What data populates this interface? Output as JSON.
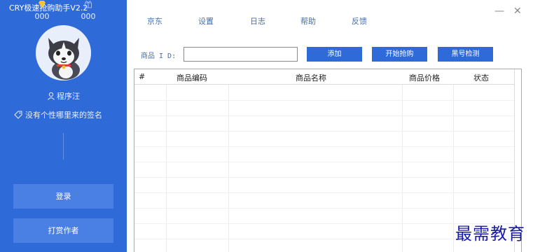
{
  "app": {
    "title": "CRY极速抢购助手V2.2"
  },
  "sidebar": {
    "username": "程序汪",
    "signature": "没有个性哪里来的签名",
    "stats": [
      {
        "icon": "diamond-icon",
        "value": "000"
      },
      {
        "icon": "gift-icon",
        "value": "000"
      }
    ],
    "login_label": "登录",
    "tip_label": "打赏作者"
  },
  "nav": {
    "items": [
      "京东",
      "设置",
      "日志",
      "帮助",
      "反馈"
    ],
    "minimize": "—",
    "close": "✕"
  },
  "toolbar": {
    "product_id_label": "商品 I D:",
    "product_id_value": "",
    "add_label": "添加",
    "start_label": "开始抢购",
    "check_label": "黑号检测"
  },
  "table": {
    "columns": [
      "#",
      "商品编码",
      "商品名称",
      "商品价格",
      "状态"
    ],
    "rows": []
  },
  "watermark": "最需教育",
  "colors": {
    "accent": "#2f6bd8",
    "sidebar_button": "#4a80e3"
  }
}
